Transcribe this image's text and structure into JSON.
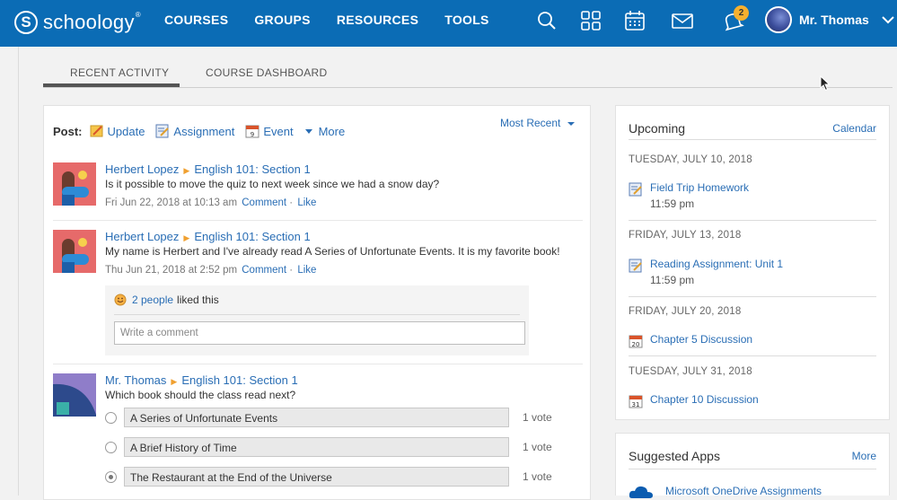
{
  "nav": {
    "brand": "schoology",
    "brand_mark": "S",
    "brand_tm": "®",
    "links": [
      "COURSES",
      "GROUPS",
      "RESOURCES",
      "TOOLS"
    ],
    "notification_count": "2",
    "user_name": "Mr. Thomas"
  },
  "tabs": {
    "recent": "RECENT ACTIVITY",
    "dashboard": "COURSE DASHBOARD"
  },
  "post": {
    "label": "Post:",
    "update": "Update",
    "assignment": "Assignment",
    "event": "Event",
    "more": "More",
    "sort": "Most Recent"
  },
  "feed": [
    {
      "author": "Herbert Lopez",
      "course": "English 101: Section 1",
      "text": "Is it possible to move the quiz to next week since we had a snow day?",
      "date": "Fri Jun 22, 2018 at 10:13 am",
      "comment": "Comment",
      "like": "Like"
    },
    {
      "author": "Herbert Lopez",
      "course": "English 101: Section 1",
      "text": "My name is Herbert and I've already read A Series of Unfortunate Events. It is my favorite book!",
      "date": "Thu Jun 21, 2018 at 2:52 pm",
      "comment": "Comment",
      "like": "Like",
      "likes_people": "2 people",
      "likes_suffix": "liked this",
      "comment_placeholder": "Write a comment"
    },
    {
      "author": "Mr. Thomas",
      "course": "English 101: Section 1",
      "text": "Which book should the class read next?",
      "poll": [
        {
          "option": "A Series of Unfortunate Events",
          "votes": "1 vote"
        },
        {
          "option": "A Brief History of Time",
          "votes": "1 vote"
        },
        {
          "option": "The Restaurant at the End of the Universe",
          "votes": "1 vote"
        }
      ]
    }
  ],
  "upcoming": {
    "title": "Upcoming",
    "calendar_link": "Calendar",
    "days": [
      {
        "date": "TUESDAY, JULY 10, 2018",
        "event": "Field Trip Homework",
        "time": "11:59 pm"
      },
      {
        "date": "FRIDAY, JULY 13, 2018",
        "event": "Reading Assignment: Unit 1",
        "time": "11:59 pm"
      },
      {
        "date": "FRIDAY, JULY 20, 2018",
        "event": "Chapter 5 Discussion",
        "cal_day": "20"
      },
      {
        "date": "TUESDAY, JULY 31, 2018",
        "event": "Chapter 10 Discussion",
        "cal_day": "31"
      }
    ]
  },
  "apps": {
    "title": "Suggested Apps",
    "more": "More",
    "first_app": "Microsoft OneDrive Assignments"
  },
  "colors": {
    "nav_bg": "#0b6cb5",
    "link": "#2a6eb5",
    "accent_orange": "#f0a030",
    "badge": "#f6b02f"
  }
}
